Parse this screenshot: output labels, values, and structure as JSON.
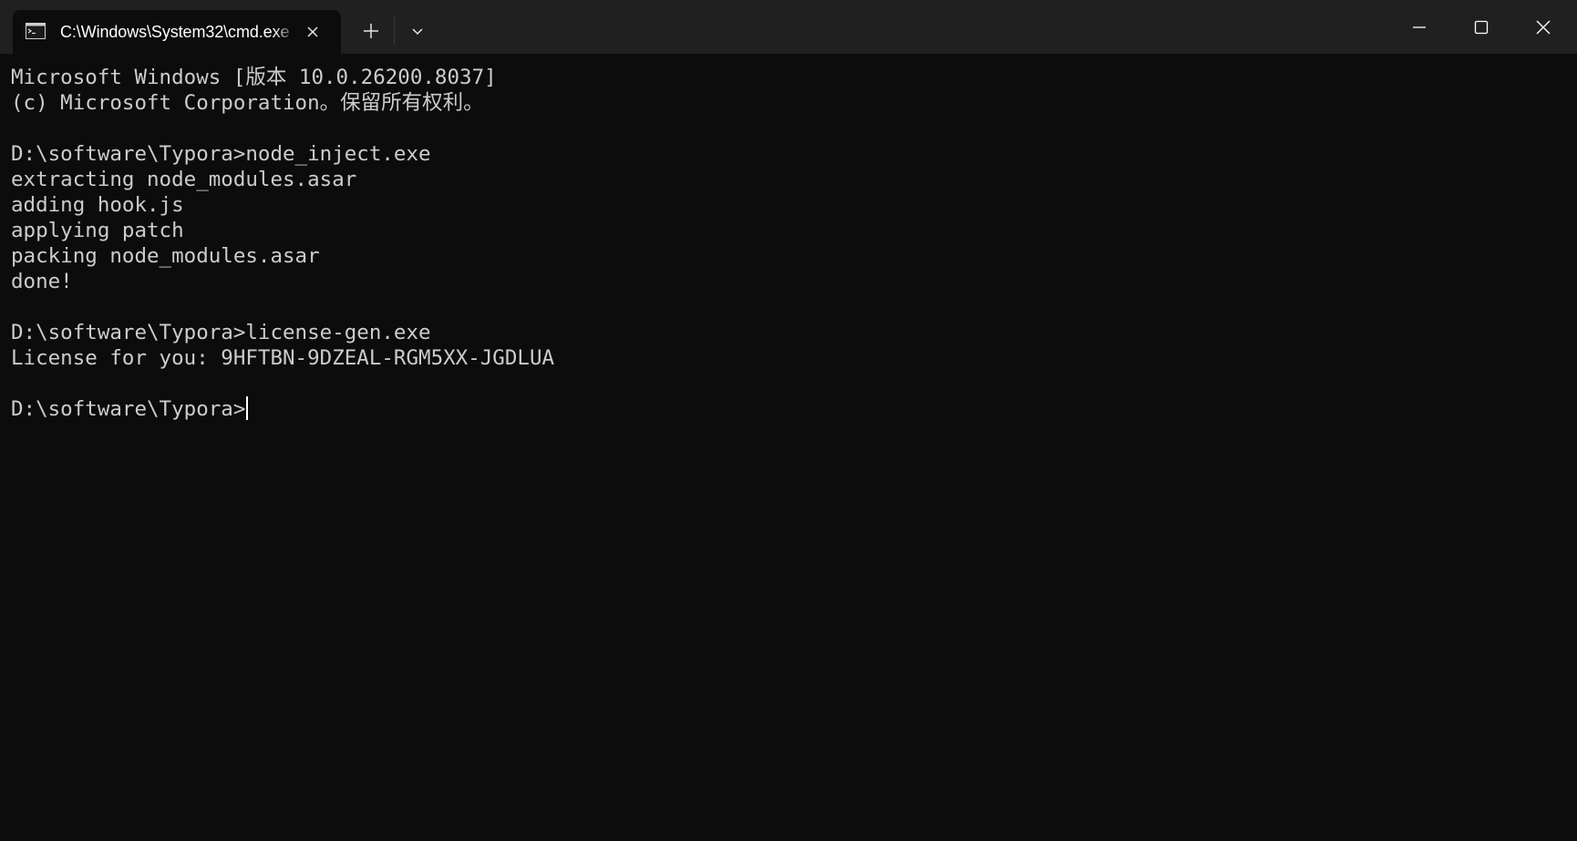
{
  "window": {
    "tab": {
      "title": "C:\\Windows\\System32\\cmd.exe",
      "icon": "command-prompt-icon",
      "close_icon": "close-icon"
    },
    "new_tab_icon": "plus-icon",
    "dropdown_icon": "chevron-down-icon",
    "controls": {
      "minimize_icon": "minimize-icon",
      "maximize_icon": "maximize-icon",
      "close_icon": "close-icon"
    },
    "colors": {
      "titlebar": "#202020",
      "background": "#0c0c0c",
      "text": "#cccccc"
    }
  },
  "terminal": {
    "lines": [
      "Microsoft Windows [版本 10.0.26200.8037]",
      "(c) Microsoft Corporation。保留所有权利。",
      "",
      "D:\\software\\Typora>node_inject.exe",
      "extracting node_modules.asar",
      "adding hook.js",
      "applying patch",
      "packing node_modules.asar",
      "done!",
      "",
      "D:\\software\\Typora>license-gen.exe",
      "License for you: 9HFTBN-9DZEAL-RGM5XX-JGDLUA",
      "",
      "D:\\software\\Typora>"
    ]
  }
}
